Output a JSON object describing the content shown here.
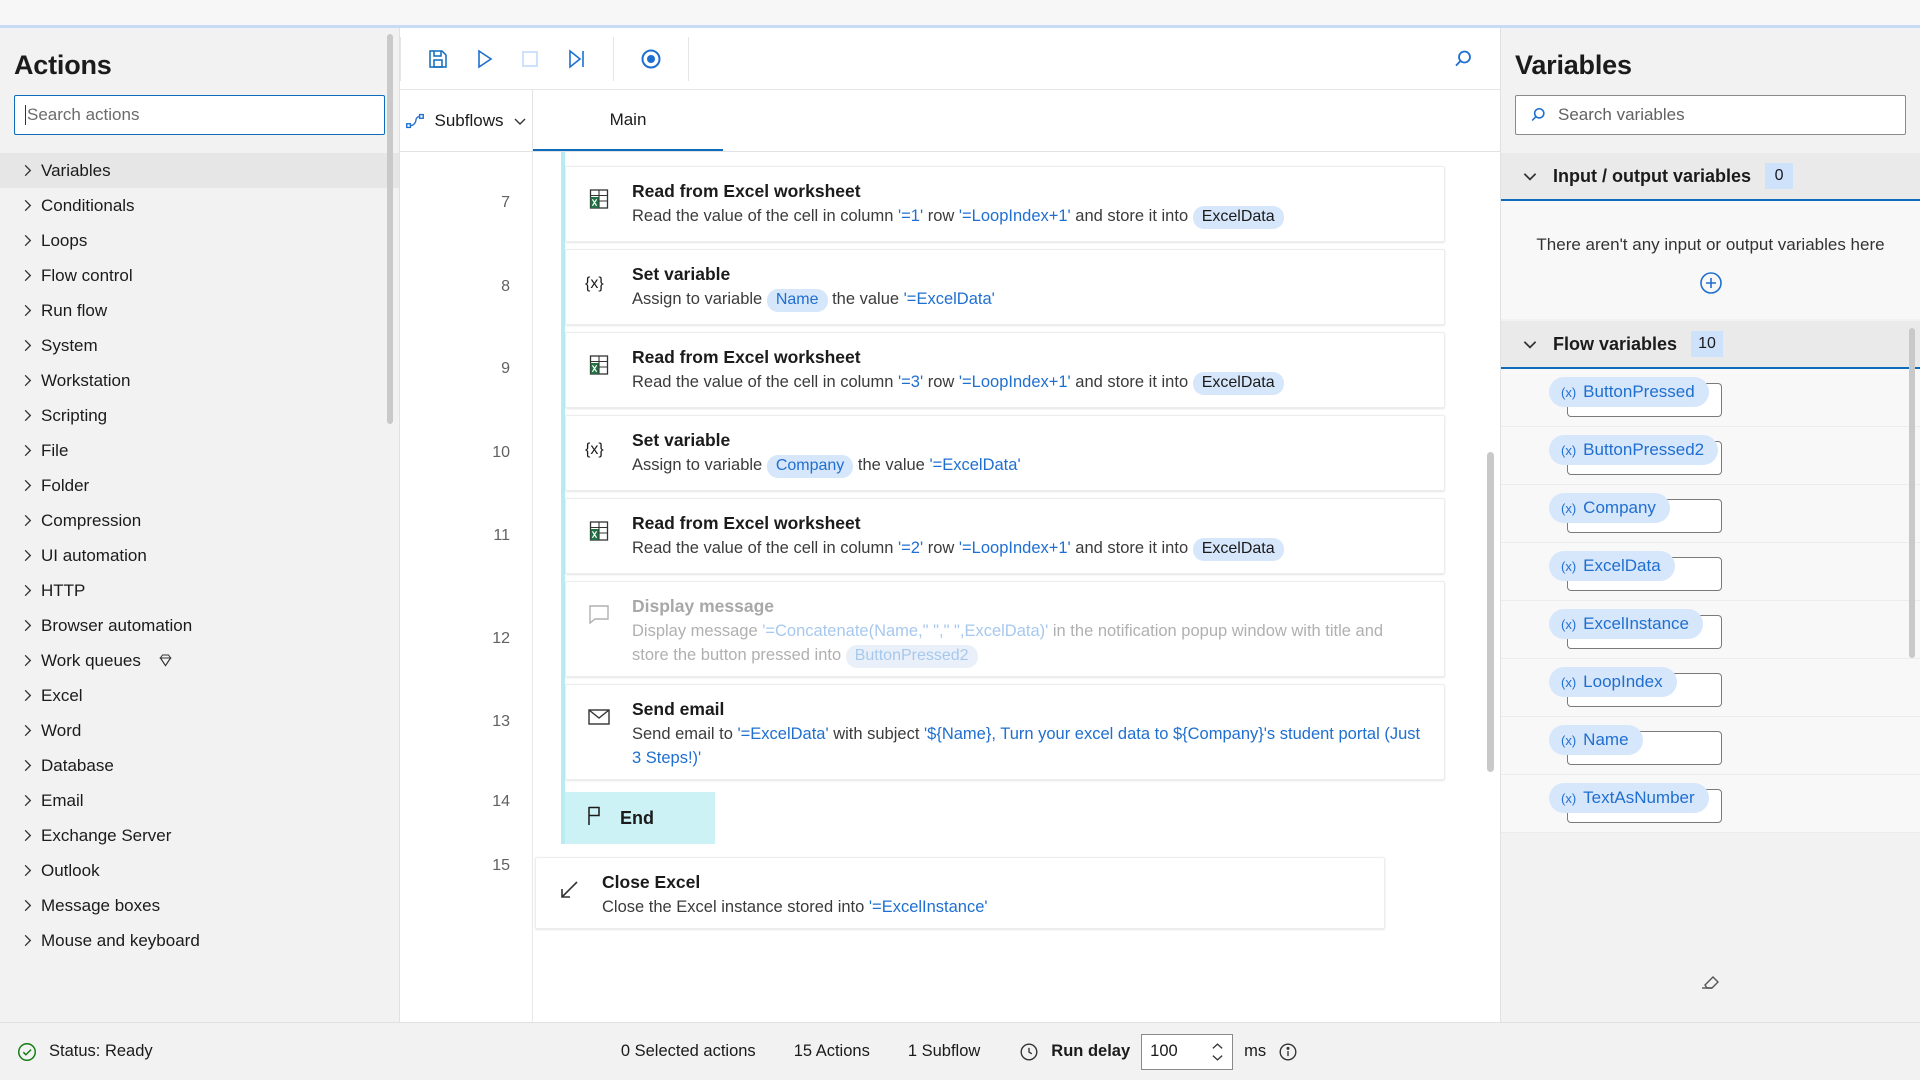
{
  "actions_panel": {
    "title": "Actions",
    "search": {
      "placeholder": "Search actions",
      "value": ""
    },
    "items": [
      {
        "label": "Variables",
        "selected": true,
        "premium": false
      },
      {
        "label": "Conditionals",
        "selected": false,
        "premium": false
      },
      {
        "label": "Loops",
        "selected": false,
        "premium": false
      },
      {
        "label": "Flow control",
        "selected": false,
        "premium": false
      },
      {
        "label": "Run flow",
        "selected": false,
        "premium": false
      },
      {
        "label": "System",
        "selected": false,
        "premium": false
      },
      {
        "label": "Workstation",
        "selected": false,
        "premium": false
      },
      {
        "label": "Scripting",
        "selected": false,
        "premium": false
      },
      {
        "label": "File",
        "selected": false,
        "premium": false
      },
      {
        "label": "Folder",
        "selected": false,
        "premium": false
      },
      {
        "label": "Compression",
        "selected": false,
        "premium": false
      },
      {
        "label": "UI automation",
        "selected": false,
        "premium": false
      },
      {
        "label": "HTTP",
        "selected": false,
        "premium": false
      },
      {
        "label": "Browser automation",
        "selected": false,
        "premium": false
      },
      {
        "label": "Work queues",
        "selected": false,
        "premium": true
      },
      {
        "label": "Excel",
        "selected": false,
        "premium": false
      },
      {
        "label": "Word",
        "selected": false,
        "premium": false
      },
      {
        "label": "Database",
        "selected": false,
        "premium": false
      },
      {
        "label": "Email",
        "selected": false,
        "premium": false
      },
      {
        "label": "Exchange Server",
        "selected": false,
        "premium": false
      },
      {
        "label": "Outlook",
        "selected": false,
        "premium": false
      },
      {
        "label": "Message boxes",
        "selected": false,
        "premium": false
      },
      {
        "label": "Mouse and keyboard",
        "selected": false,
        "premium": false
      }
    ]
  },
  "toolbar": {
    "save_label": "Save",
    "run_label": "Run",
    "stop_label": "Stop",
    "run_next_label": "Run next action",
    "record_label": "Record",
    "search_label": "Search"
  },
  "tabs": {
    "subflows_label": "Subflows",
    "main_label": "Main"
  },
  "canvas": {
    "line_numbers": [
      "7",
      "8",
      "9",
      "10",
      "11",
      "12",
      "13",
      "14",
      "15"
    ],
    "rows": [
      {
        "icon": "excel-worksheet-icon",
        "title": "Read from Excel worksheet",
        "disabled": false,
        "segments": [
          {
            "t": "Read the value of the cell in column ",
            "s": "plain"
          },
          {
            "t": "'=1'",
            "s": "blue"
          },
          {
            "t": " row ",
            "s": "plain"
          },
          {
            "t": "'=LoopIndex+1'",
            "s": "blue"
          },
          {
            "t": " and store it into ",
            "s": "plain"
          },
          {
            "t": "ExcelData",
            "s": "chip"
          }
        ]
      },
      {
        "icon": "set-variable-icon",
        "title": "Set variable",
        "disabled": false,
        "segments": [
          {
            "t": "Assign to variable ",
            "s": "plain"
          },
          {
            "t": "Name",
            "s": "chip-blue"
          },
          {
            "t": " the value ",
            "s": "plain"
          },
          {
            "t": "'=ExcelData'",
            "s": "blue"
          }
        ]
      },
      {
        "icon": "excel-worksheet-icon",
        "title": "Read from Excel worksheet",
        "disabled": false,
        "segments": [
          {
            "t": "Read the value of the cell in column ",
            "s": "plain"
          },
          {
            "t": "'=3'",
            "s": "blue"
          },
          {
            "t": " row ",
            "s": "plain"
          },
          {
            "t": "'=LoopIndex+1'",
            "s": "blue"
          },
          {
            "t": " and store it into ",
            "s": "plain"
          },
          {
            "t": "ExcelData",
            "s": "chip"
          }
        ]
      },
      {
        "icon": "set-variable-icon",
        "title": "Set variable",
        "disabled": false,
        "segments": [
          {
            "t": "Assign to variable ",
            "s": "plain"
          },
          {
            "t": "Company",
            "s": "chip-blue"
          },
          {
            "t": " the value ",
            "s": "plain"
          },
          {
            "t": "'=ExcelData'",
            "s": "blue"
          }
        ]
      },
      {
        "icon": "excel-worksheet-icon",
        "title": "Read from Excel worksheet",
        "disabled": false,
        "segments": [
          {
            "t": "Read the value of the cell in column ",
            "s": "plain"
          },
          {
            "t": "'=2'",
            "s": "blue"
          },
          {
            "t": " row ",
            "s": "plain"
          },
          {
            "t": "'=LoopIndex+1'",
            "s": "blue"
          },
          {
            "t": " and store it into ",
            "s": "plain"
          },
          {
            "t": "ExcelData",
            "s": "chip"
          }
        ]
      },
      {
        "icon": "display-message-icon",
        "title": "Display message",
        "disabled": true,
        "segments": [
          {
            "t": "Display message ",
            "s": "plain"
          },
          {
            "t": "'=Concatenate(Name,\" \",\" \",ExcelData)'",
            "s": "blue"
          },
          {
            "t": " in the notification popup window with title and store the button pressed into ",
            "s": "plain"
          },
          {
            "t": "ButtonPressed2",
            "s": "chip-blue"
          }
        ]
      },
      {
        "icon": "send-email-icon",
        "title": "Send email",
        "disabled": false,
        "segments": [
          {
            "t": "Send email to ",
            "s": "plain"
          },
          {
            "t": "'=ExcelData'",
            "s": "blue"
          },
          {
            "t": " with subject ",
            "s": "plain"
          },
          {
            "t": "'${Name}, Turn your excel data to ${Company}'s student portal (Just 3 Steps!)'",
            "s": "blue"
          }
        ]
      }
    ],
    "end_block": {
      "label": "End",
      "icon": "flag-icon"
    },
    "close_row": {
      "icon": "close-excel-icon",
      "title": "Close Excel",
      "disabled": false,
      "segments": [
        {
          "t": "Close the Excel instance stored into ",
          "s": "plain"
        },
        {
          "t": "'=ExcelInstance'",
          "s": "blue"
        }
      ]
    }
  },
  "variables_panel": {
    "title": "Variables",
    "search": {
      "placeholder": "Search variables",
      "value": ""
    },
    "io_section": {
      "title": "Input / output variables",
      "count": "0",
      "empty_text": "There aren't any input or output variables here",
      "add_label": "Add input or output variable"
    },
    "flow_section": {
      "title": "Flow variables",
      "count": "10",
      "variables": [
        {
          "name": "ButtonPressed",
          "tag": "(x)"
        },
        {
          "name": "ButtonPressed2",
          "tag": "(x)"
        },
        {
          "name": "Company",
          "tag": "(x)"
        },
        {
          "name": "ExcelData",
          "tag": "(x)"
        },
        {
          "name": "ExcelInstance",
          "tag": "(x)"
        },
        {
          "name": "LoopIndex",
          "tag": "(x)"
        },
        {
          "name": "Name",
          "tag": "(x)"
        },
        {
          "name": "TextAsNumber",
          "tag": "(x)"
        }
      ]
    },
    "footer_icon": "eraser-icon"
  },
  "statusbar": {
    "status_text": "Status: Ready",
    "selected_actions": "0 Selected actions",
    "actions_count": "15 Actions",
    "subflow_count": "1 Subflow",
    "run_delay_label": "Run delay",
    "run_delay_value": "100",
    "ms_label": "ms",
    "info_label": "More information"
  },
  "colors": {
    "accent_blue": "#0f6cbd",
    "link_blue": "#1f6fd0",
    "chip_bg": "#d6e6fb",
    "end_block_bg": "#cdf2f5",
    "indent_guide": "#b9ecf2",
    "panel_bg": "#f2f2f2",
    "status_green": "#107c10"
  }
}
